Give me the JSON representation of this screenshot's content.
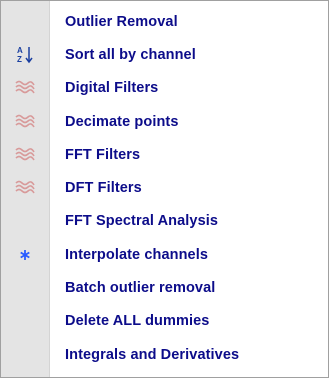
{
  "menu": {
    "items": [
      {
        "label": "Outlier Removal",
        "icon": "none"
      },
      {
        "label": "Sort all by channel",
        "icon": "sort-az-icon"
      },
      {
        "label": "Digital Filters",
        "icon": "filter-wave-icon"
      },
      {
        "label": "Decimate points",
        "icon": "filter-wave-icon"
      },
      {
        "label": "FFT Filters",
        "icon": "filter-wave-icon"
      },
      {
        "label": "DFT Filters",
        "icon": "filter-wave-icon"
      },
      {
        "label": "FFT Spectral Analysis",
        "icon": "none"
      },
      {
        "label": "Interpolate channels",
        "icon": "asterisk-icon"
      },
      {
        "label": "Batch outlier removal",
        "icon": "none"
      },
      {
        "label": "Delete ALL dummies",
        "icon": "none"
      },
      {
        "label": "Integrals and Derivatives",
        "icon": "none"
      }
    ]
  },
  "colors": {
    "label_text": "#0c0c8a",
    "gutter": "#e4e4e4",
    "wave_icon": "#d89a9a",
    "asterisk_icon": "#2a5cff",
    "sort_icon": "#1a3fa0"
  }
}
